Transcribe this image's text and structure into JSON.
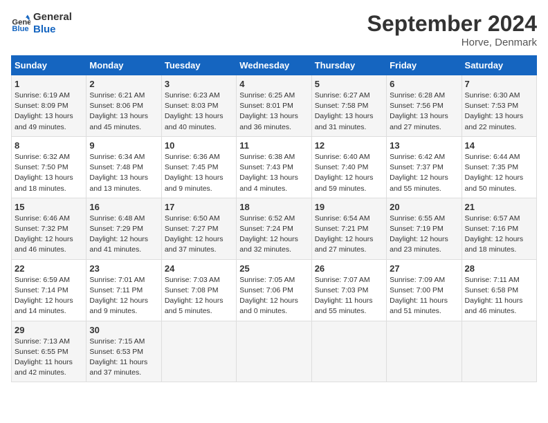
{
  "header": {
    "logo_line1": "General",
    "logo_line2": "Blue",
    "title": "September 2024",
    "location": "Horve, Denmark"
  },
  "days": [
    "Sunday",
    "Monday",
    "Tuesday",
    "Wednesday",
    "Thursday",
    "Friday",
    "Saturday"
  ],
  "weeks": [
    [
      {
        "day": "1",
        "text": "Sunrise: 6:19 AM\nSunset: 8:09 PM\nDaylight: 13 hours\nand 49 minutes."
      },
      {
        "day": "2",
        "text": "Sunrise: 6:21 AM\nSunset: 8:06 PM\nDaylight: 13 hours\nand 45 minutes."
      },
      {
        "day": "3",
        "text": "Sunrise: 6:23 AM\nSunset: 8:03 PM\nDaylight: 13 hours\nand 40 minutes."
      },
      {
        "day": "4",
        "text": "Sunrise: 6:25 AM\nSunset: 8:01 PM\nDaylight: 13 hours\nand 36 minutes."
      },
      {
        "day": "5",
        "text": "Sunrise: 6:27 AM\nSunset: 7:58 PM\nDaylight: 13 hours\nand 31 minutes."
      },
      {
        "day": "6",
        "text": "Sunrise: 6:28 AM\nSunset: 7:56 PM\nDaylight: 13 hours\nand 27 minutes."
      },
      {
        "day": "7",
        "text": "Sunrise: 6:30 AM\nSunset: 7:53 PM\nDaylight: 13 hours\nand 22 minutes."
      }
    ],
    [
      {
        "day": "8",
        "text": "Sunrise: 6:32 AM\nSunset: 7:50 PM\nDaylight: 13 hours\nand 18 minutes."
      },
      {
        "day": "9",
        "text": "Sunrise: 6:34 AM\nSunset: 7:48 PM\nDaylight: 13 hours\nand 13 minutes."
      },
      {
        "day": "10",
        "text": "Sunrise: 6:36 AM\nSunset: 7:45 PM\nDaylight: 13 hours\nand 9 minutes."
      },
      {
        "day": "11",
        "text": "Sunrise: 6:38 AM\nSunset: 7:43 PM\nDaylight: 13 hours\nand 4 minutes."
      },
      {
        "day": "12",
        "text": "Sunrise: 6:40 AM\nSunset: 7:40 PM\nDaylight: 12 hours\nand 59 minutes."
      },
      {
        "day": "13",
        "text": "Sunrise: 6:42 AM\nSunset: 7:37 PM\nDaylight: 12 hours\nand 55 minutes."
      },
      {
        "day": "14",
        "text": "Sunrise: 6:44 AM\nSunset: 7:35 PM\nDaylight: 12 hours\nand 50 minutes."
      }
    ],
    [
      {
        "day": "15",
        "text": "Sunrise: 6:46 AM\nSunset: 7:32 PM\nDaylight: 12 hours\nand 46 minutes."
      },
      {
        "day": "16",
        "text": "Sunrise: 6:48 AM\nSunset: 7:29 PM\nDaylight: 12 hours\nand 41 minutes."
      },
      {
        "day": "17",
        "text": "Sunrise: 6:50 AM\nSunset: 7:27 PM\nDaylight: 12 hours\nand 37 minutes."
      },
      {
        "day": "18",
        "text": "Sunrise: 6:52 AM\nSunset: 7:24 PM\nDaylight: 12 hours\nand 32 minutes."
      },
      {
        "day": "19",
        "text": "Sunrise: 6:54 AM\nSunset: 7:21 PM\nDaylight: 12 hours\nand 27 minutes."
      },
      {
        "day": "20",
        "text": "Sunrise: 6:55 AM\nSunset: 7:19 PM\nDaylight: 12 hours\nand 23 minutes."
      },
      {
        "day": "21",
        "text": "Sunrise: 6:57 AM\nSunset: 7:16 PM\nDaylight: 12 hours\nand 18 minutes."
      }
    ],
    [
      {
        "day": "22",
        "text": "Sunrise: 6:59 AM\nSunset: 7:14 PM\nDaylight: 12 hours\nand 14 minutes."
      },
      {
        "day": "23",
        "text": "Sunrise: 7:01 AM\nSunset: 7:11 PM\nDaylight: 12 hours\nand 9 minutes."
      },
      {
        "day": "24",
        "text": "Sunrise: 7:03 AM\nSunset: 7:08 PM\nDaylight: 12 hours\nand 5 minutes."
      },
      {
        "day": "25",
        "text": "Sunrise: 7:05 AM\nSunset: 7:06 PM\nDaylight: 12 hours\nand 0 minutes."
      },
      {
        "day": "26",
        "text": "Sunrise: 7:07 AM\nSunset: 7:03 PM\nDaylight: 11 hours\nand 55 minutes."
      },
      {
        "day": "27",
        "text": "Sunrise: 7:09 AM\nSunset: 7:00 PM\nDaylight: 11 hours\nand 51 minutes."
      },
      {
        "day": "28",
        "text": "Sunrise: 7:11 AM\nSunset: 6:58 PM\nDaylight: 11 hours\nand 46 minutes."
      }
    ],
    [
      {
        "day": "29",
        "text": "Sunrise: 7:13 AM\nSunset: 6:55 PM\nDaylight: 11 hours\nand 42 minutes."
      },
      {
        "day": "30",
        "text": "Sunrise: 7:15 AM\nSunset: 6:53 PM\nDaylight: 11 hours\nand 37 minutes."
      },
      {
        "day": "",
        "text": ""
      },
      {
        "day": "",
        "text": ""
      },
      {
        "day": "",
        "text": ""
      },
      {
        "day": "",
        "text": ""
      },
      {
        "day": "",
        "text": ""
      }
    ]
  ]
}
